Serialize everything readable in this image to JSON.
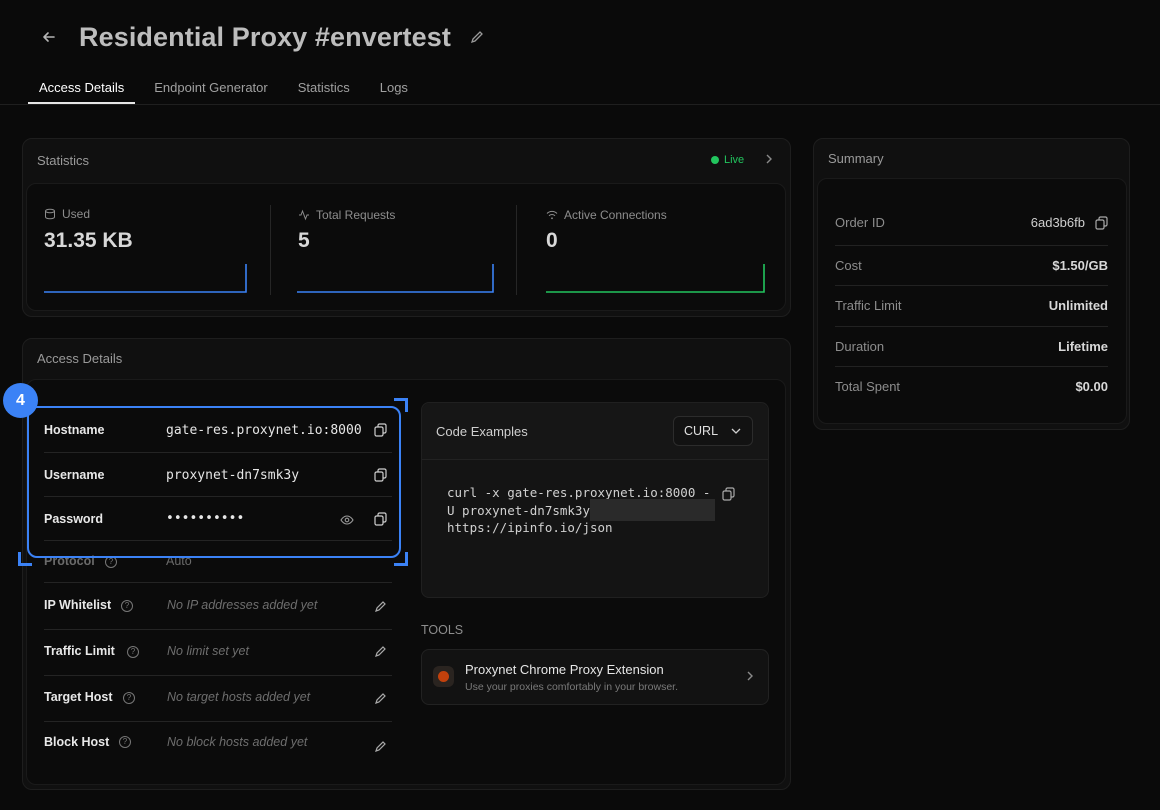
{
  "header": {
    "back_icon": "arrow-left-icon",
    "title": "Residential Proxy #envertest",
    "edit_icon": "pencil-icon"
  },
  "tabs": [
    {
      "label": "Access Details",
      "active": true
    },
    {
      "label": "Endpoint Generator",
      "active": false
    },
    {
      "label": "Statistics",
      "active": false
    },
    {
      "label": "Logs",
      "active": false
    }
  ],
  "statistics": {
    "title": "Statistics",
    "live_label": "Live",
    "items": [
      {
        "label": "Used",
        "value": "31.35 KB",
        "icon": "database-icon",
        "color": "#3b82f6"
      },
      {
        "label": "Total Requests",
        "value": "5",
        "icon": "activity-icon",
        "color": "#3b82f6"
      },
      {
        "label": "Active Connections",
        "value": "0",
        "icon": "wifi-icon",
        "color": "#22c55e"
      }
    ]
  },
  "access": {
    "title": "Access Details",
    "highlight_badge": "4",
    "rows": [
      {
        "label": "Hostname",
        "value": "gate-res.proxynet.io:8000"
      },
      {
        "label": "Username",
        "value": "proxynet-dn7smk3y"
      },
      {
        "label": "Password",
        "value": "••••••••••"
      },
      {
        "label": "Protocol",
        "value": "Auto"
      },
      {
        "label": "IP Whitelist",
        "value": "No IP addresses added yet"
      },
      {
        "label": "Traffic Limit",
        "value": "No limit set yet"
      },
      {
        "label": "Target Host",
        "value": "No target hosts added yet"
      },
      {
        "label": "Block Host",
        "value": "No block hosts added yet"
      }
    ]
  },
  "code_examples": {
    "title": "Code Examples",
    "language": "CURL",
    "lines": [
      "curl -x gate-res.proxynet.io:8000 -",
      "U proxynet-dn7smk3y",
      "https://ipinfo.io/json"
    ]
  },
  "tools": {
    "heading": "TOOLS",
    "item_title": "Proxynet Chrome Proxy Extension",
    "item_subtitle": "Use your proxies comfortably in your browser."
  },
  "summary": {
    "title": "Summary",
    "rows": [
      {
        "label": "Order ID",
        "value": "6ad3b6fb"
      },
      {
        "label": "Cost",
        "value": "$1.50/GB"
      },
      {
        "label": "Traffic Limit",
        "value": "Unlimited"
      },
      {
        "label": "Duration",
        "value": "Lifetime"
      },
      {
        "label": "Total Spent",
        "value": "$0.00"
      }
    ]
  },
  "colors": {
    "accent": "#3b82f6",
    "live": "#22c55e",
    "highlight": "#3b82f6"
  }
}
